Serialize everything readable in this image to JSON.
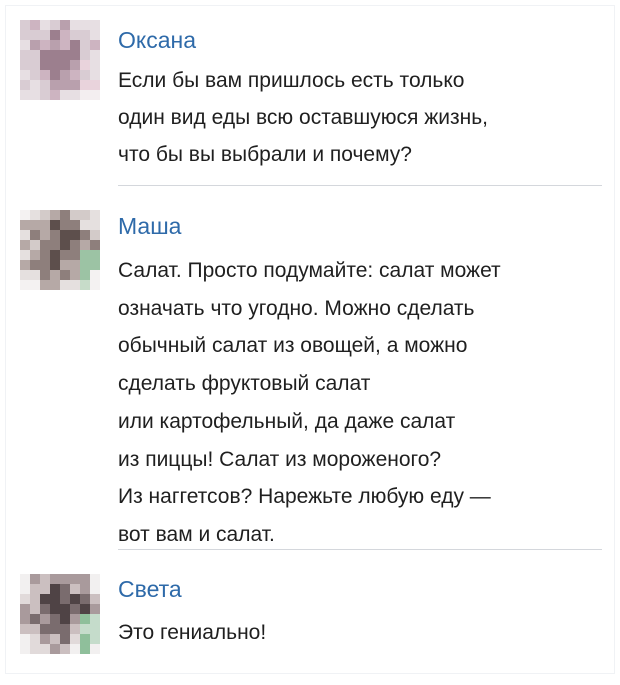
{
  "messages": [
    {
      "author": "Оксана",
      "lines": [
        "Если бы вам пришлось есть только",
        "один вид еды всю оставшуюся жизнь,",
        "что бы вы выбрали и почему?"
      ]
    },
    {
      "author": "Маша",
      "lines": [
        "Салат. Просто подумайте: салат может",
        "означать что угодно. Можно сделать",
        "обычный салат из овощей, а можно",
        "сделать фруктовый салат",
        "или картофельный, да даже салат",
        "из пиццы! Салат из мороженого?",
        "Из наггетсов? Нарежьте любую еду —",
        "вот вам и салат."
      ]
    },
    {
      "author": "Света",
      "lines": [
        "Это гениально!"
      ]
    }
  ],
  "colors": {
    "author_name": "#2e6aa9",
    "message_text": "#1f1f1f",
    "divider": "#d4d7dc"
  }
}
